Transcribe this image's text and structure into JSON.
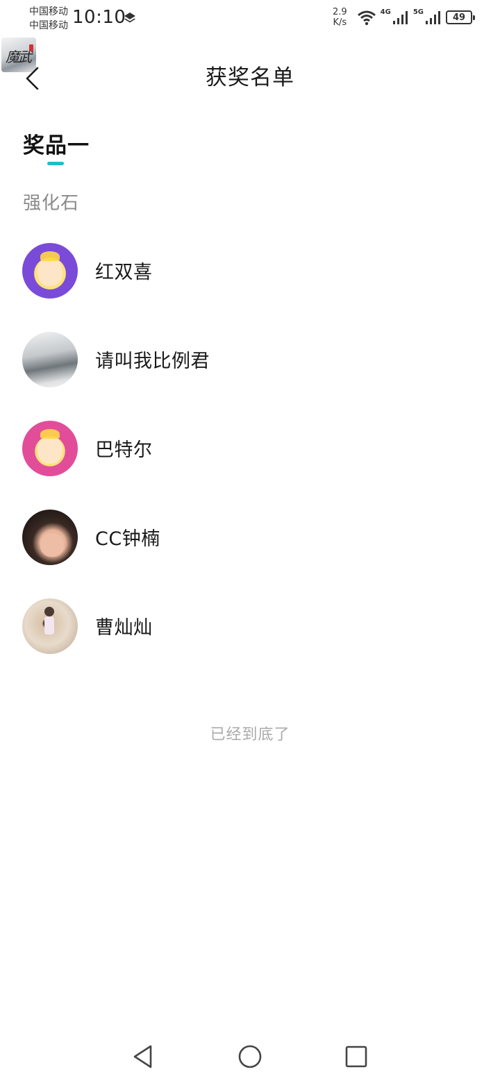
{
  "status_bar": {
    "carrier_1": "中国移动",
    "carrier_2": "中国移动",
    "time": "10:10",
    "net_speed_value": "2.9",
    "net_speed_unit": "K/s",
    "signal_1_label": "4G",
    "signal_2_label": "5G",
    "battery_level": "49",
    "icons": [
      "layers-icon",
      "wifi-icon",
      "signal-icon",
      "signal-icon",
      "battery-icon"
    ]
  },
  "floating_app": {
    "label": "魔武"
  },
  "header": {
    "title": "获奖名单",
    "back_icon": "chevron-left-icon"
  },
  "tab": {
    "label": "奖品一",
    "indicator_color": "#1bbfc5"
  },
  "prize": {
    "name": "强化石"
  },
  "winners": [
    {
      "name": "红双喜"
    },
    {
      "name": "请叫我比例君"
    },
    {
      "name": "巴特尔"
    },
    {
      "name": "CC钟楠"
    },
    {
      "name": "曹灿灿"
    }
  ],
  "list_end_text": "已经到底了",
  "system_nav": {
    "icons": [
      "back-triangle-icon",
      "home-circle-icon",
      "recents-square-icon"
    ]
  }
}
